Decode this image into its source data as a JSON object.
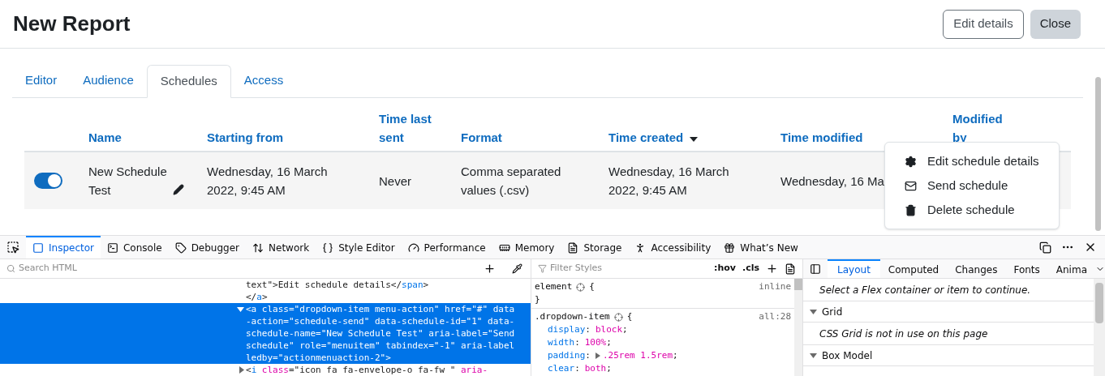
{
  "page": {
    "title": "New Report",
    "buttons": [
      {
        "label": "Edit details",
        "kind": "outline"
      },
      {
        "label": "Close",
        "kind": "filled"
      }
    ]
  },
  "tabs": [
    {
      "label": "Editor",
      "selected": false
    },
    {
      "label": "Audience",
      "selected": false
    },
    {
      "label": "Schedules",
      "selected": true
    },
    {
      "label": "Access",
      "selected": false
    }
  ],
  "table": {
    "columns": [
      {
        "label": "Name",
        "sorted": false
      },
      {
        "label": "Starting from",
        "sorted": false
      },
      {
        "label": "Time last sent",
        "sorted": false
      },
      {
        "label": "Format",
        "sorted": false
      },
      {
        "label": "Time created",
        "sorted": true
      },
      {
        "label": "Time modified",
        "sorted": false
      },
      {
        "label": "Modified by",
        "sorted": false
      }
    ],
    "rows": [
      {
        "enabled": true,
        "cells": [
          "New Schedule Test",
          "Wednesday, 16 March 2022, 9:45 AM",
          "Never",
          "Comma separated values (.csv)",
          "Wednesday, 16 March 2022, 9:45 AM",
          "Wednesday, 16 Ma"
        ]
      }
    ]
  },
  "action_menu": {
    "items": [
      {
        "label": "Edit schedule details",
        "kind": "gear"
      },
      {
        "label": "Send schedule",
        "kind": "envelope"
      },
      {
        "label": "Delete schedule",
        "kind": "trash"
      }
    ]
  },
  "devtools": {
    "tabs": [
      {
        "label": "Inspector",
        "kind": "inspector",
        "selected": true
      },
      {
        "label": "Console",
        "kind": "console",
        "selected": false
      },
      {
        "label": "Debugger",
        "kind": "debugger",
        "selected": false
      },
      {
        "label": "Network",
        "kind": "network",
        "selected": false
      },
      {
        "label": "Style Editor",
        "kind": "style",
        "selected": false
      },
      {
        "label": "Performance",
        "kind": "performance",
        "selected": false
      },
      {
        "label": "Memory",
        "kind": "memory",
        "selected": false
      },
      {
        "label": "Storage",
        "kind": "storage",
        "selected": false
      },
      {
        "label": "Accessibility",
        "kind": "accessibility",
        "selected": false
      },
      {
        "label": "What’s New",
        "kind": "whatsnew",
        "selected": false
      }
    ],
    "search_placeholder": "Search HTML",
    "filter_placeholder": "Filter Styles",
    "hov": ":hov",
    "cls": ".cls",
    "sidebar_tabs": [
      {
        "label": "Layout",
        "selected": true
      },
      {
        "label": "Computed",
        "selected": false
      },
      {
        "label": "Changes",
        "selected": false
      },
      {
        "label": "Fonts",
        "selected": false
      },
      {
        "label": "Anima",
        "selected": false
      }
    ],
    "html_lines": [
      {
        "selected": false,
        "tokens": [
          {
            "kind": "plain",
            "text": "text\">Edit schedule details</"
          },
          {
            "kind": "tag",
            "text": "span"
          },
          {
            "kind": "plain",
            "text": ">"
          }
        ]
      },
      {
        "selected": false,
        "tokens": [
          {
            "kind": "plain",
            "text": "</"
          },
          {
            "kind": "tag",
            "text": "a"
          },
          {
            "kind": "plain",
            "text": ">"
          }
        ]
      },
      {
        "selected": true,
        "expanded": true,
        "tokens": [
          {
            "kind": "plain",
            "text": "<a class=\"dropdown-item menu-action\" href=\"#\" data-action=\"schedule-send\" data-schedule-id=\"1\" data-schedule-name=\"New Schedule Test\" aria-label=\"Send schedule\" role=\"menuitem\" tabindex=\"-1\" aria-labelledby=\"actionmenuaction-2\">"
          }
        ]
      },
      {
        "selected": false,
        "expanded": false,
        "tokens": [
          {
            "kind": "plain",
            "text": "<"
          },
          {
            "kind": "tag",
            "text": "i"
          },
          {
            "kind": "attr",
            "text": " class"
          },
          {
            "kind": "plain",
            "text": "=\"icon fa fa-envelope-o fa-fw \" "
          },
          {
            "kind": "attr",
            "text": "aria-"
          }
        ]
      }
    ],
    "rules": [
      {
        "selector": "element",
        "open": "{",
        "close": "}",
        "source": "inline"
      },
      {
        "selector": ".dropdown-item",
        "open": "{",
        "source": "all:28",
        "declarations": [
          {
            "expandable": false,
            "tokens": [
              {
                "kind": "prop",
                "text": "display"
              },
              {
                "kind": "plain",
                "text": ":"
              },
              {
                "kind": "value",
                "text": "block"
              },
              {
                "kind": "plain",
                "text": ";"
              }
            ]
          },
          {
            "expandable": false,
            "tokens": [
              {
                "kind": "prop",
                "text": "width"
              },
              {
                "kind": "plain",
                "text": ":"
              },
              {
                "kind": "value",
                "text": "100%"
              },
              {
                "kind": "plain",
                "text": ";"
              }
            ]
          },
          {
            "expandable": true,
            "tokens": [
              {
                "kind": "prop",
                "text": "padding"
              },
              {
                "kind": "plain",
                "text": ":"
              },
              {
                "kind": "value",
                "text": ".25rem 1.5rem"
              },
              {
                "kind": "plain",
                "text": ";"
              }
            ]
          },
          {
            "expandable": false,
            "tokens": [
              {
                "kind": "prop",
                "text": "clear"
              },
              {
                "kind": "plain",
                "text": ":"
              },
              {
                "kind": "value",
                "text": "both"
              },
              {
                "kind": "plain",
                "text": ";"
              }
            ]
          }
        ]
      }
    ],
    "layout_sections": [
      {
        "kind": "note",
        "text": "Select a Flex container or item to continue."
      },
      {
        "kind": "header",
        "text": "Grid",
        "expanded": true
      },
      {
        "kind": "note",
        "text": "CSS Grid is not in use on this page"
      },
      {
        "kind": "header",
        "text": "Box Model",
        "expanded": true
      }
    ]
  }
}
